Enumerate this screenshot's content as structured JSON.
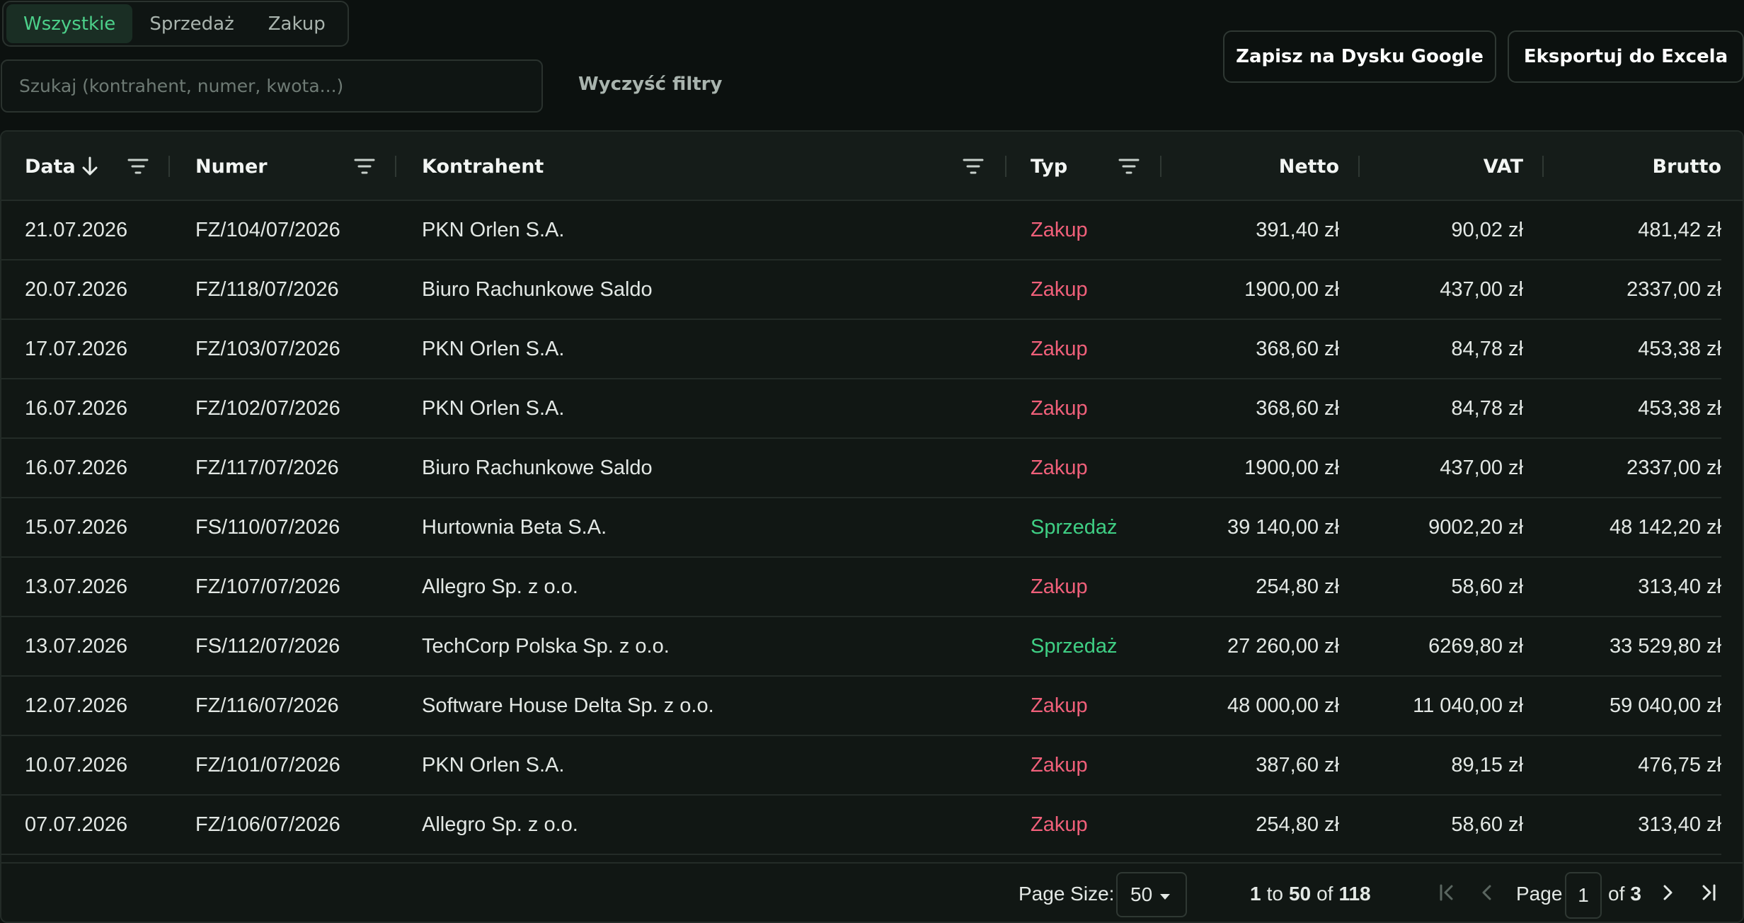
{
  "tabs": [
    {
      "label": "Wszystkie",
      "active": true
    },
    {
      "label": "Sprzedaż",
      "active": false
    },
    {
      "label": "Zakup",
      "active": false
    }
  ],
  "search": {
    "placeholder": "Szukaj (kontrahent, numer, kwota...)"
  },
  "actions": {
    "clear_filters": "Wyczyść filtry",
    "save_google": "Zapisz na Dysku Google",
    "export_excel": "Eksportuj do Excela"
  },
  "columns": {
    "date": "Data",
    "number": "Numer",
    "contractor": "Kontrahent",
    "type": "Typ",
    "net": "Netto",
    "vat": "VAT",
    "gross": "Brutto"
  },
  "colors": {
    "accent": "#4cd08a",
    "purchase": "#f0607a",
    "sale": "#3fcf84"
  },
  "rows": [
    {
      "date": "21.07.2026",
      "number": "FZ/104/07/2026",
      "contractor": "PKN Orlen S.A.",
      "type": "Zakup",
      "net": "391,40 zł",
      "vat": "90,02 zł",
      "gross": "481,42 zł"
    },
    {
      "date": "20.07.2026",
      "number": "FZ/118/07/2026",
      "contractor": "Biuro Rachunkowe Saldo",
      "type": "Zakup",
      "net": "1900,00 zł",
      "vat": "437,00 zł",
      "gross": "2337,00 zł"
    },
    {
      "date": "17.07.2026",
      "number": "FZ/103/07/2026",
      "contractor": "PKN Orlen S.A.",
      "type": "Zakup",
      "net": "368,60 zł",
      "vat": "84,78 zł",
      "gross": "453,38 zł"
    },
    {
      "date": "16.07.2026",
      "number": "FZ/102/07/2026",
      "contractor": "PKN Orlen S.A.",
      "type": "Zakup",
      "net": "368,60 zł",
      "vat": "84,78 zł",
      "gross": "453,38 zł"
    },
    {
      "date": "16.07.2026",
      "number": "FZ/117/07/2026",
      "contractor": "Biuro Rachunkowe Saldo",
      "type": "Zakup",
      "net": "1900,00 zł",
      "vat": "437,00 zł",
      "gross": "2337,00 zł"
    },
    {
      "date": "15.07.2026",
      "number": "FS/110/07/2026",
      "contractor": "Hurtownia Beta S.A.",
      "type": "Sprzedaż",
      "net": "39 140,00 zł",
      "vat": "9002,20 zł",
      "gross": "48 142,20 zł"
    },
    {
      "date": "13.07.2026",
      "number": "FZ/107/07/2026",
      "contractor": "Allegro Sp. z o.o.",
      "type": "Zakup",
      "net": "254,80 zł",
      "vat": "58,60 zł",
      "gross": "313,40 zł"
    },
    {
      "date": "13.07.2026",
      "number": "FS/112/07/2026",
      "contractor": "TechCorp Polska Sp. z o.o.",
      "type": "Sprzedaż",
      "net": "27 260,00 zł",
      "vat": "6269,80 zł",
      "gross": "33 529,80 zł"
    },
    {
      "date": "12.07.2026",
      "number": "FZ/116/07/2026",
      "contractor": "Software House Delta Sp. z o.o.",
      "type": "Zakup",
      "net": "48 000,00 zł",
      "vat": "11 040,00 zł",
      "gross": "59 040,00 zł"
    },
    {
      "date": "10.07.2026",
      "number": "FZ/101/07/2026",
      "contractor": "PKN Orlen S.A.",
      "type": "Zakup",
      "net": "387,60 zł",
      "vat": "89,15 zł",
      "gross": "476,75 zł"
    },
    {
      "date": "07.07.2026",
      "number": "FZ/106/07/2026",
      "contractor": "Allegro Sp. z o.o.",
      "type": "Zakup",
      "net": "254,80 zł",
      "vat": "58,60 zł",
      "gross": "313,40 zł"
    }
  ],
  "pagination": {
    "page_size_label": "Page Size:",
    "page_size": "50",
    "range_from": "1",
    "range_to_word": "to",
    "range_to": "50",
    "of_word": "of",
    "total": "118",
    "page_label": "Page",
    "page": "1",
    "pages_of": "of",
    "pages_total": "3"
  }
}
